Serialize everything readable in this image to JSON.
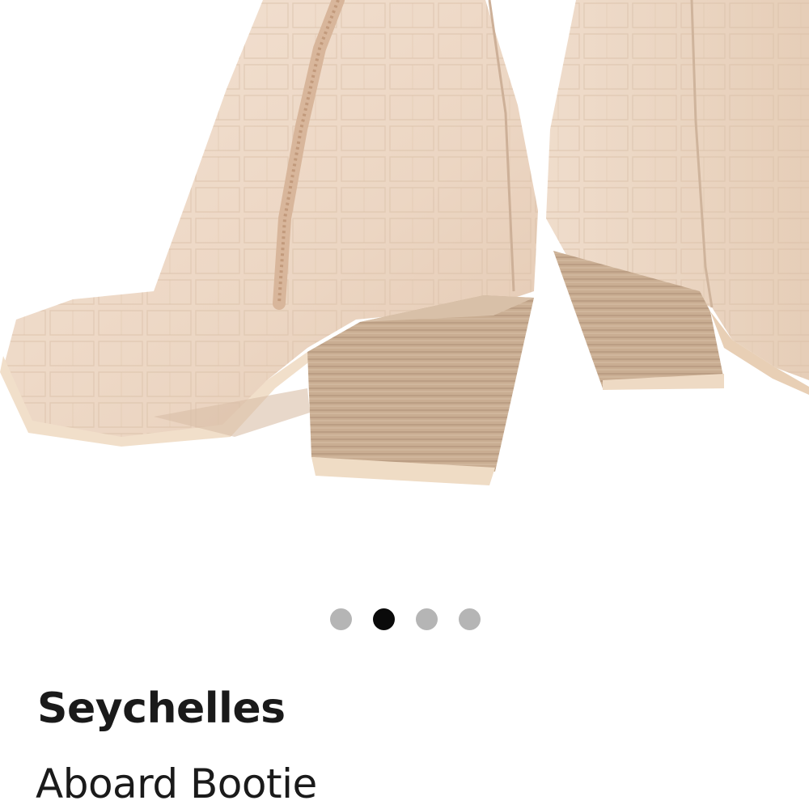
{
  "product": {
    "brand": "Seychelles",
    "name": "Aboard Bootie"
  },
  "carousel": {
    "total_images": 4,
    "active_index": 2,
    "active_color": "#0a0a0a",
    "inactive_color": "#b5b5b5"
  },
  "image": {
    "subject_icon": "ankle-boots-photo"
  }
}
